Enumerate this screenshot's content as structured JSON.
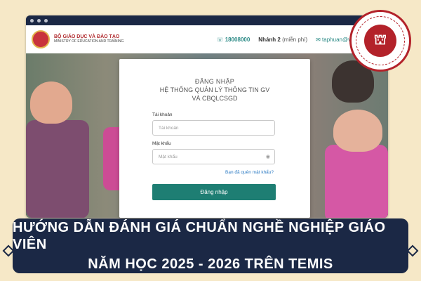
{
  "header": {
    "brand_line1": "BỘ GIÁO DỤC VÀ ĐÀO TẠO",
    "brand_line2": "MINISTRY OF EDUCATION AND TRAINING",
    "phone": "18008000",
    "extension": "Nhánh 2",
    "fee_note": "(miễn phí)",
    "email": "taphuan@viettel.com.vn"
  },
  "login": {
    "title_line1": "ĐĂNG NHẬP",
    "title_line2": "HỆ THỐNG QUẢN LÝ THÔNG TIN GV",
    "title_line3": "VÀ CBQLCSGD",
    "username_label": "Tài khoản",
    "username_placeholder": "Tài khoản",
    "password_label": "Mật khẩu",
    "password_placeholder": "Mật khẩu",
    "forgot": "Bạn đã quên mật khẩu?",
    "submit": "Đăng nhập"
  },
  "banner": {
    "line1": "HƯỚNG DẪN ĐÁNH GIÁ CHUẨN NGHỀ NGHIỆP GIÁO VIÊN",
    "line2": "NĂM HỌC 2025 - 2026 TRÊN TEMIS"
  },
  "colors": {
    "navy": "#1b2845",
    "teal": "#1e7e73",
    "cream": "#f6e8c7",
    "red": "#b3222a"
  },
  "icons": {
    "phone": "phone-icon",
    "mail": "mail-icon",
    "eye": "eye-icon"
  }
}
